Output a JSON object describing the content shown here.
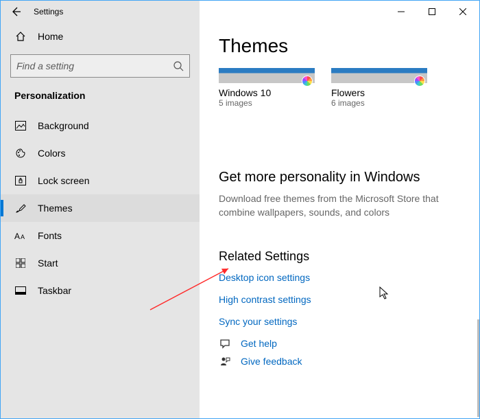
{
  "window": {
    "app_title": "Settings"
  },
  "sidebar": {
    "home_label": "Home",
    "search_placeholder": "Find a setting",
    "section_title": "Personalization",
    "items": [
      {
        "label": "Background"
      },
      {
        "label": "Colors"
      },
      {
        "label": "Lock screen"
      },
      {
        "label": "Themes"
      },
      {
        "label": "Fonts"
      },
      {
        "label": "Start"
      },
      {
        "label": "Taskbar"
      }
    ]
  },
  "main": {
    "heading": "Themes",
    "themes": [
      {
        "name": "Windows 10",
        "sub": "5 images"
      },
      {
        "name": "Flowers",
        "sub": "6 images"
      }
    ],
    "more_heading": "Get more personality in Windows",
    "more_desc": "Download free themes from the Microsoft Store that combine wallpapers, sounds, and colors",
    "related_heading": "Related Settings",
    "related_links": [
      "Desktop icon settings",
      "High contrast settings",
      "Sync your settings"
    ],
    "help_label": "Get help",
    "feedback_label": "Give feedback"
  }
}
